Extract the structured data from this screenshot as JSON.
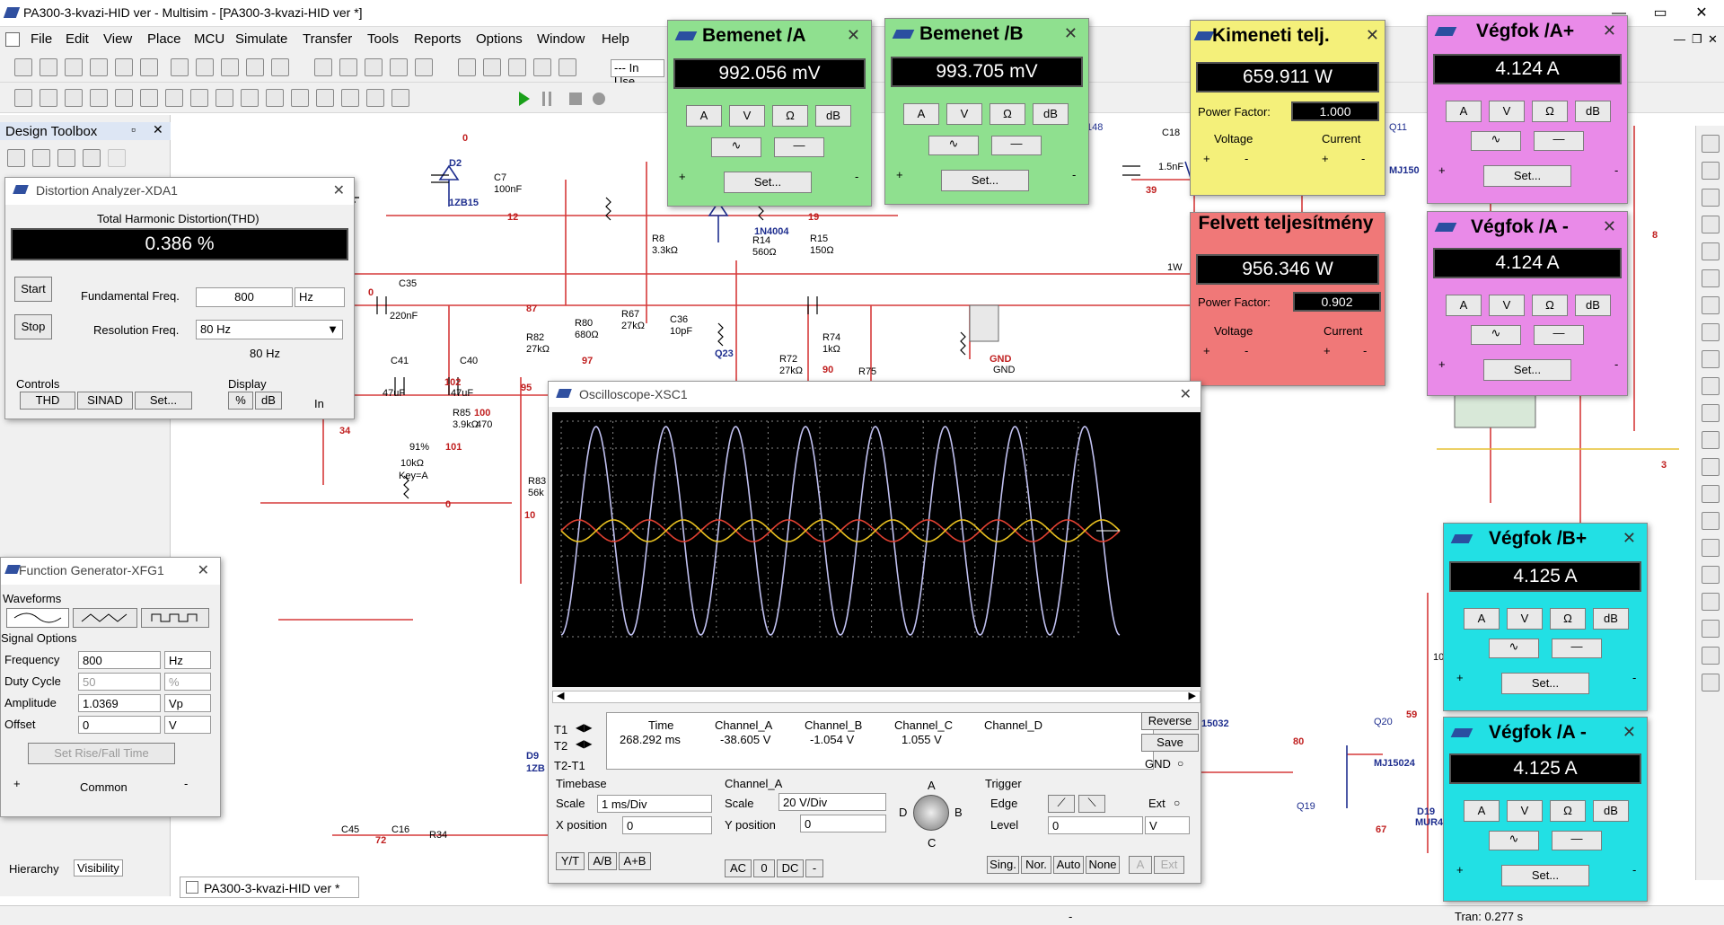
{
  "app": {
    "title": "PA300-3-kvazi-HID ver - Multisim - [PA300-3-kvazi-HID ver *]",
    "min": "—",
    "max": "▭",
    "close": "✕",
    "doc_min": "—",
    "doc_max": "❐",
    "doc_close": "✕"
  },
  "menu": [
    "File",
    "Edit",
    "View",
    "Place",
    "MCU",
    "Simulate",
    "Transfer",
    "Tools",
    "Reports",
    "Options",
    "Window",
    "Help"
  ],
  "toolbar": {
    "in_use": "--- In Use"
  },
  "design_toolbox": {
    "title": "Design Toolbox",
    "tab_hierarchy": "Hierarchy",
    "tab_visibility": "Visibility"
  },
  "doc_tab": "PA300-3-kvazi-HID ver *",
  "status": {
    "tran": "Tran: 0.277 s",
    "dash": "-"
  },
  "distortion": {
    "title": "Distortion Analyzer-XDA1",
    "thd_label": "Total Harmonic Distortion(THD)",
    "thd_value": "0.386 %",
    "start": "Start",
    "stop": "Stop",
    "fund_label": "Fundamental Freq.",
    "fund_value": "800",
    "fund_unit": "Hz",
    "res_label": "Resolution Freq.",
    "res_value": "80 Hz",
    "res_display": "80 Hz",
    "controls_label": "Controls",
    "thd_btn": "THD",
    "sinad_btn": "SINAD",
    "set_btn": "Set...",
    "display_label": "Display",
    "pct_btn": "%",
    "db_btn": "dB",
    "in_label": "In"
  },
  "funcgen": {
    "title": "Function Generator-XFG1",
    "waveforms_label": "Waveforms",
    "signal_label": "Signal Options",
    "rows": [
      {
        "label": "Frequency",
        "value": "800",
        "unit": "Hz"
      },
      {
        "label": "Duty Cycle",
        "value": "50",
        "unit": "%"
      },
      {
        "label": "Amplitude",
        "value": "1.0369",
        "unit": "Vp"
      },
      {
        "label": "Offset",
        "value": "0",
        "unit": "V"
      }
    ],
    "rise_fall": "Set Rise/Fall Time",
    "common": "Common",
    "plus": "+",
    "minus": "-"
  },
  "meters": {
    "bemenet_a": {
      "title": "Bemenet /A",
      "value": "992.056 mV",
      "color": "#8fe08f"
    },
    "bemenet_b": {
      "title": "Bemenet /B",
      "value": "993.705 mV",
      "color": "#8fe08f"
    },
    "vegfok_ap": {
      "title": "Végfok /A+",
      "value": "4.124 A",
      "color": "#e98ae8"
    },
    "vegfok_am": {
      "title": "Végfok /A -",
      "value": "4.124 A",
      "color": "#e98ae8"
    },
    "vegfok_bp": {
      "title": "Végfok /B+",
      "value": "4.125 A",
      "color": "#22e0e4"
    },
    "vegfok_am2": {
      "title": "Végfok /A -",
      "value": "4.125 A",
      "color": "#22e0e4"
    },
    "btn_a": "A",
    "btn_v": "V",
    "btn_ohm": "Ω",
    "btn_db": "dB",
    "set": "Set...",
    "plus": "+",
    "minus": "-"
  },
  "wattmeters": {
    "kimeneti": {
      "title": "Kimeneti telj.",
      "value": "659.911 W",
      "pf_label": "Power Factor:",
      "pf_value": "1.000",
      "color": "#f4f07a"
    },
    "felvett": {
      "title": "Felvett teljesítmény",
      "value": "956.346 W",
      "pf_label": "Power Factor:",
      "pf_value": "0.902",
      "color": "#f07878"
    },
    "voltage": "Voltage",
    "current": "Current",
    "plus": "+",
    "minus": "-"
  },
  "scope": {
    "title": "Oscilloscope-XSC1",
    "t1": "T1",
    "t2": "T2",
    "t2t1": "T2-T1",
    "headers": [
      "Time",
      "Channel_A",
      "Channel_B",
      "Channel_C",
      "Channel_D"
    ],
    "values": [
      "268.292 ms",
      "-38.605 V",
      "-1.054 V",
      "1.055 V",
      ""
    ],
    "reverse": "Reverse",
    "save": "Save",
    "gnd": "GND",
    "timebase_label": "Timebase",
    "scale_label": "Scale",
    "scale_value": "1 ms/Div",
    "xpos_label": "X position",
    "xpos_value": "0",
    "yt": "Y/T",
    "ab": "A/B",
    "apb": "A+B",
    "chA_label": "Channel_A",
    "chA_scale_label": "Scale",
    "chA_scale": "20  V/Div",
    "ypos_label": "Y position",
    "ypos_value": "0",
    "ac": "AC",
    "zero": "0",
    "dc": "DC",
    "dash": "-",
    "knob_a": "A",
    "knob_b": "B",
    "knob_c": "C",
    "knob_d": "D",
    "trigger_label": "Trigger",
    "edge_label": "Edge",
    "level_label": "Level",
    "level_value": "0",
    "level_unit": "V",
    "ext_label": "Ext",
    "sing": "Sing.",
    "nor": "Nor.",
    "auto": "Auto",
    "none": "None",
    "a_btn": "A",
    "ext_btn": "Ext"
  },
  "schematic": {
    "labels": [
      "D2",
      "1ZB15",
      "C7",
      "100nF",
      "12",
      "0",
      "R8",
      "3.3kΩ",
      "1N4004",
      "19",
      "R14",
      "560Ω",
      "R15",
      "150Ω",
      "C35",
      "220nF",
      "0",
      "87",
      "R82",
      "27kΩ",
      "R80",
      "680Ω",
      "R67",
      "27kΩ",
      "C36",
      "10pF",
      "97",
      "Q23",
      "R72",
      "27kΩ",
      "R74",
      "1kΩ",
      "90",
      "R75",
      "C41",
      "47uF",
      "C40",
      "47uF",
      "102",
      "95",
      "R85",
      "3.9kΩ",
      "100",
      "470",
      "91%",
      "101",
      "10kΩ",
      "Key=A",
      "0",
      "34",
      "R83",
      "56k",
      "10",
      "C18",
      "1.5nF",
      "39",
      "1W",
      "148",
      "Q11",
      "MJ150",
      "GND",
      "GND",
      "C45",
      "72",
      "C16",
      "R34",
      "D9",
      "1ZB",
      "15032",
      "80",
      "Q20",
      "59",
      "MJ15024",
      "Q19",
      "D19",
      "MUR4",
      "67",
      "10",
      "8",
      "3"
    ]
  }
}
